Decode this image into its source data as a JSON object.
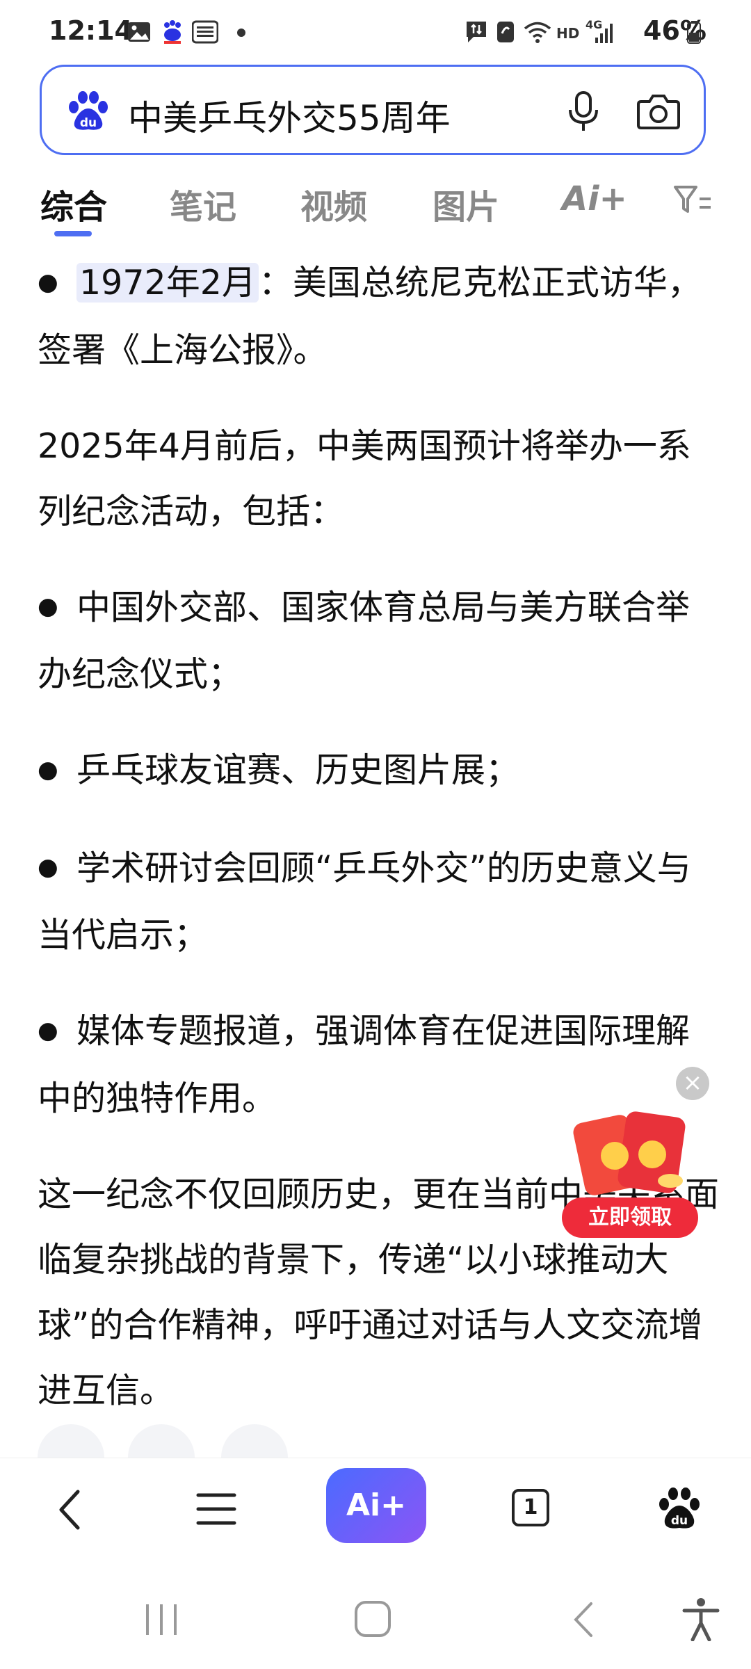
{
  "status_bar": {
    "time": "12:14",
    "hd": "HD",
    "network": "4G",
    "battery": "46%"
  },
  "search": {
    "query": "中美乒乓外交55周年"
  },
  "tabs": [
    {
      "label": "综合",
      "active": true
    },
    {
      "label": "笔记"
    },
    {
      "label": "视频"
    },
    {
      "label": "图片"
    },
    {
      "label": "Ai+"
    }
  ],
  "article": {
    "p1_date": "1972年2月",
    "p1_text": "：美国总统尼克松正式访华，签署《上海公报》。",
    "p2": "2025年4月前后，中美两国预计将举办一系列纪念活动，包括：",
    "b1": "中国外交部、国家体育总局与美方联合举办纪念仪式；",
    "b2": "乒乓球友谊赛、历史图片展；",
    "b3": "学术研讨会回顾“乒乓外交”的历史意义与当代启示；",
    "b4": "媒体专题报道，强调体育在促进国际理解中的独特作用。",
    "p3": "这一纪念不仅回顾历史，更在当前中美关系面临复杂挑战的背景下，传递“以小球推动大球”的合作精神，呼吁通过对话与人文交流增进互信。"
  },
  "promo": {
    "button_label": "立即领取"
  },
  "bottom_nav": {
    "ai_label": "Ai+",
    "tab_count": "1"
  },
  "colors": {
    "accent": "#4e6ef2",
    "promo_red": "#ee2b3a"
  }
}
